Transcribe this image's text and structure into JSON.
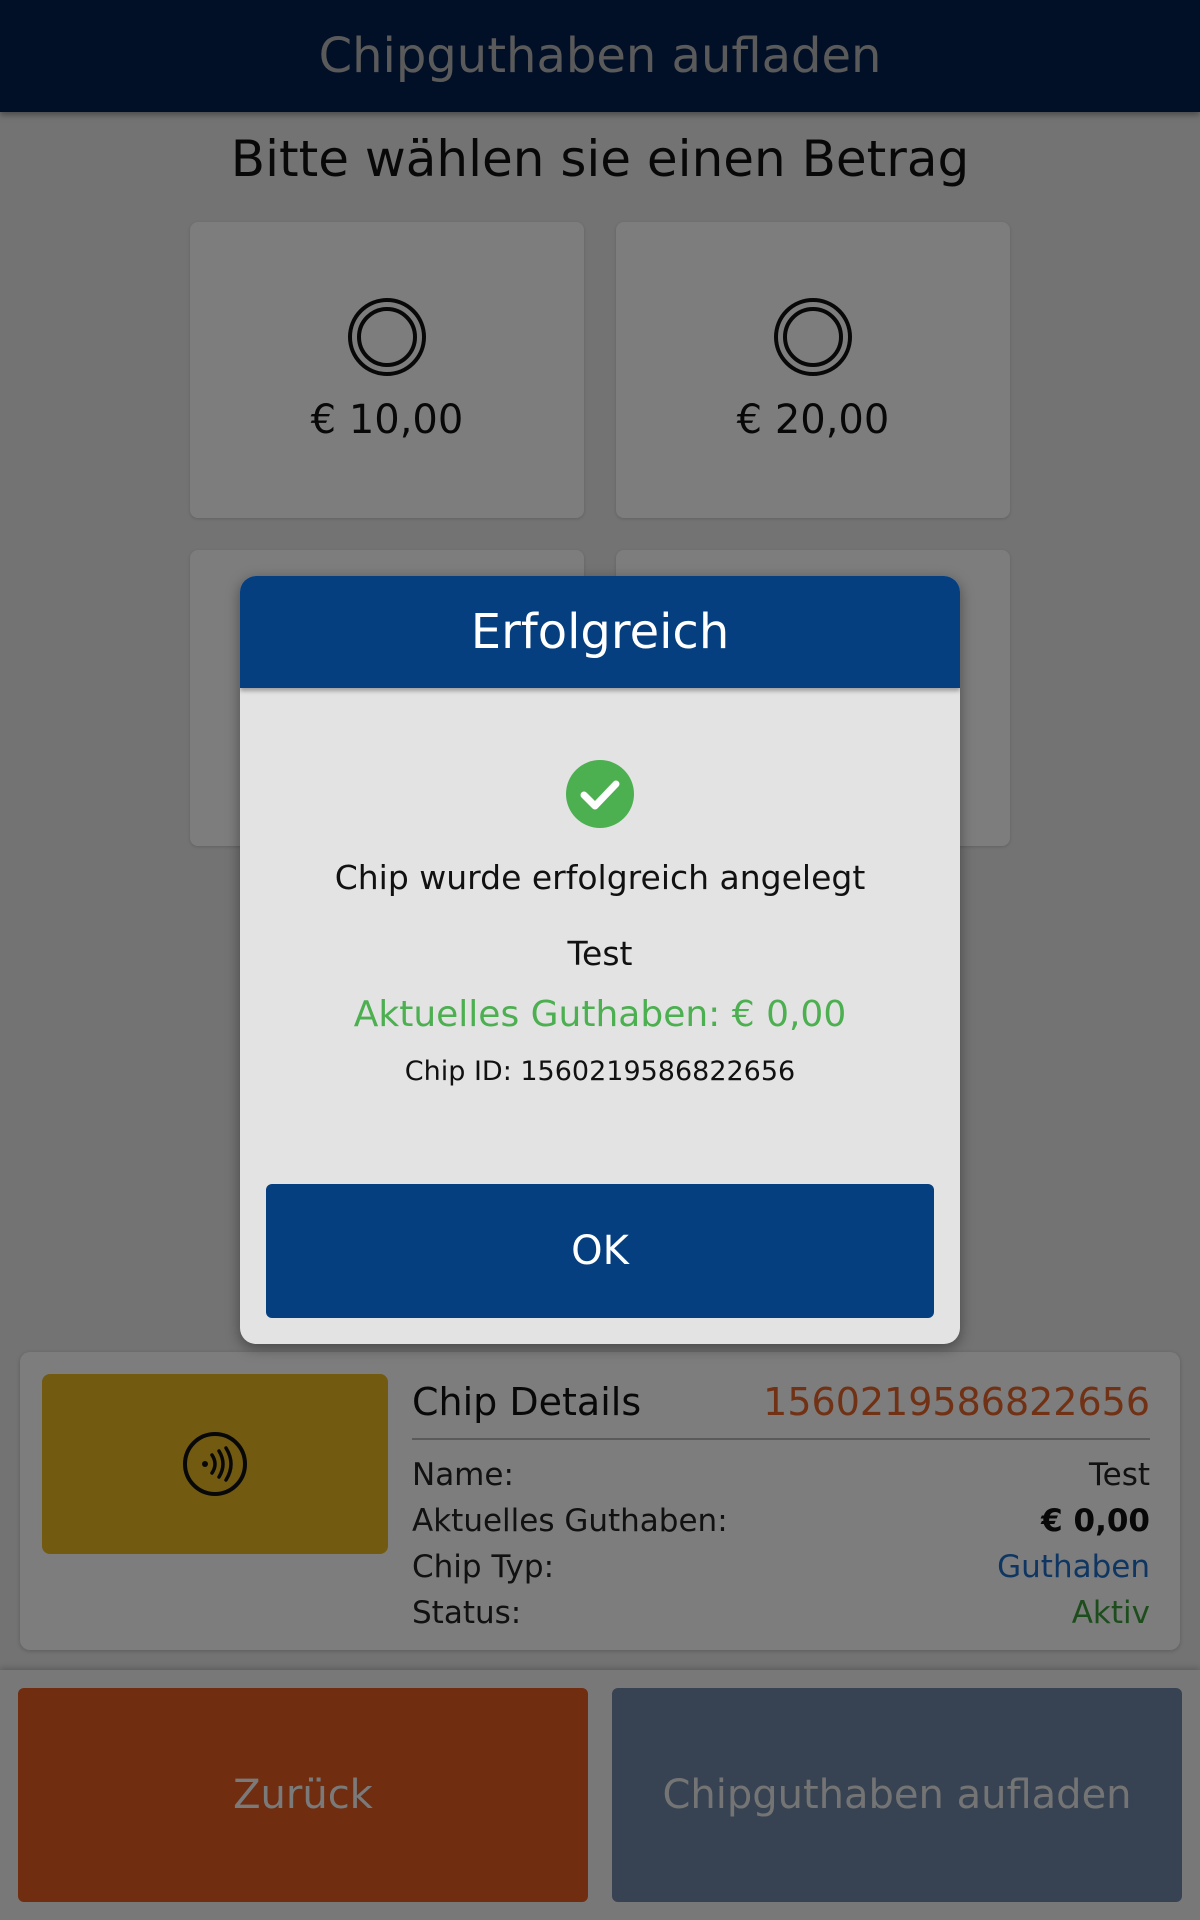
{
  "header": {
    "title": "Chipguthaben aufladen"
  },
  "main": {
    "prompt": "Bitte wählen sie einen Betrag",
    "amounts": [
      {
        "label": "€ 10,00"
      },
      {
        "label": "€ 20,00"
      }
    ]
  },
  "chip_details": {
    "title": "Chip Details",
    "id": "1560219586822656",
    "rows": [
      {
        "label": "Name:",
        "value": "Test"
      },
      {
        "label": "Aktuelles Guthaben:",
        "value": "€ 0,00"
      },
      {
        "label": "Chip Typ:",
        "value": "Guthaben"
      },
      {
        "label": "Status:",
        "value": "Aktiv"
      }
    ]
  },
  "footer": {
    "back_label": "Zurück",
    "load_label": "Chipguthaben aufladen"
  },
  "dialog": {
    "title": "Erfolgreich",
    "message": "Chip wurde erfolgreich angelegt",
    "name": "Test",
    "balance": "Aktuelles Guthaben: € 0,00",
    "chip_id": "Chip ID: 1560219586822656",
    "ok_label": "OK"
  },
  "icons": {
    "amount_tile": "coin-icon",
    "chip_card": "nfc-icon",
    "dialog": "check-circle-icon"
  },
  "colors": {
    "header": "#05214f",
    "dialog_header": "#053f80",
    "back_button": "#e05a1e",
    "load_button": "#6f87a4",
    "chip_card": "#e5b520",
    "chip_id": "#e2622a",
    "balance_green": "#4caf50",
    "chip_type_blue": "#1f6cc5",
    "status_green": "#3a9a3a"
  }
}
